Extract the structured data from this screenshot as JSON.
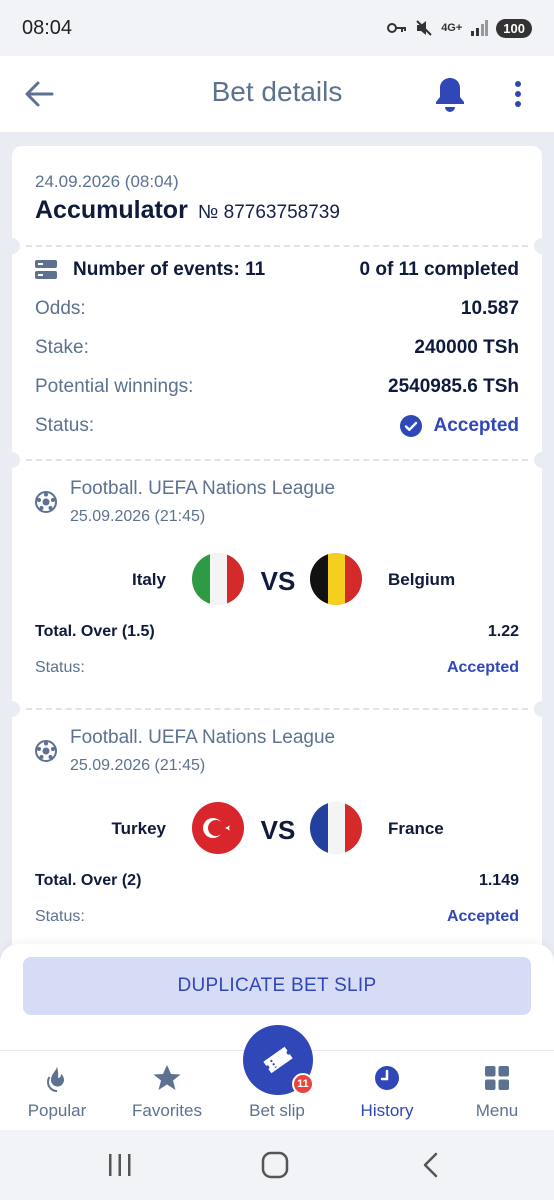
{
  "status_bar": {
    "time": "08:04",
    "network": "4G+",
    "battery": "100"
  },
  "app_bar": {
    "title": "Bet details"
  },
  "bet": {
    "date": "24.09.2026 (08:04)",
    "type": "Accumulator",
    "number": "№ 87763758739",
    "events_label": "Number of events: 11",
    "completed": "0 of 11 completed",
    "odds_label": "Odds:",
    "odds": "10.587",
    "stake_label": "Stake:",
    "stake": "240000 TSh",
    "winnings_label": "Potential winnings:",
    "winnings": "2540985.6 TSh",
    "status_label": "Status:",
    "status": "Accepted"
  },
  "events": [
    {
      "league": "Football. UEFA Nations League",
      "date": "25.09.2026 (21:45)",
      "home": "Italy",
      "away": "Belgium",
      "vs": "VS",
      "selection": "Total. Over (1.5)",
      "odds": "1.22",
      "status_label": "Status:",
      "status": "Accepted"
    },
    {
      "league": "Football. UEFA Nations League",
      "date": "25.09.2026 (21:45)",
      "home": "Turkey",
      "away": "France",
      "vs": "VS",
      "selection": "Total. Over (2)",
      "odds": "1.149",
      "status_label": "Status:",
      "status": "Accepted"
    }
  ],
  "actions": {
    "duplicate": "DUPLICATE BET SLIP"
  },
  "nav": {
    "popular": "Popular",
    "favorites": "Favorites",
    "betslip": "Bet slip",
    "betslip_badge": "11",
    "history": "History",
    "menu": "Menu"
  },
  "colors": {
    "accent": "#3047b8",
    "muted": "#5c7290",
    "badge": "#e8453c"
  }
}
